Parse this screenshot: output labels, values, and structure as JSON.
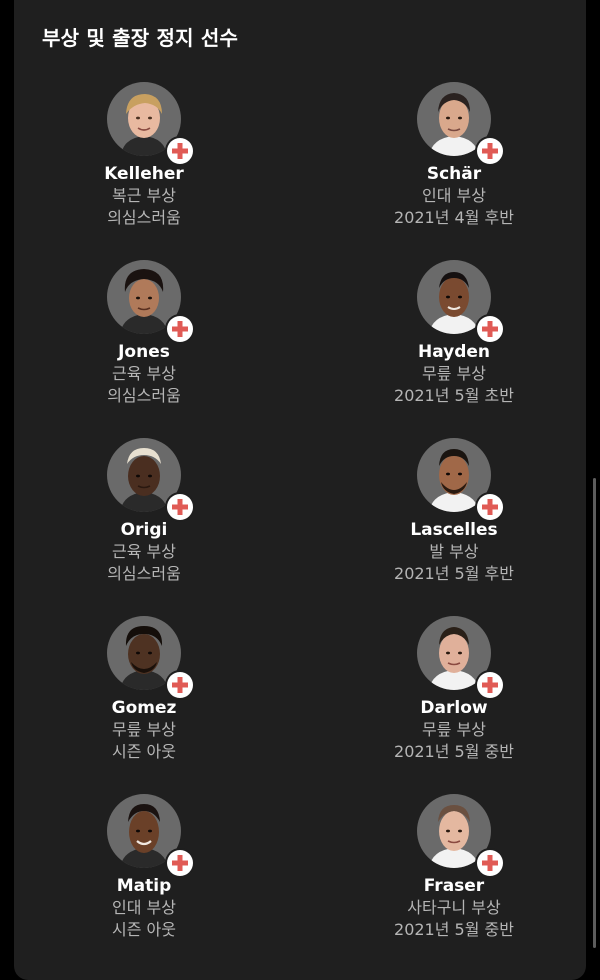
{
  "title": "부상 및 출장 정지 선수",
  "colors": {
    "background": "#1f1f1f",
    "badge_cross": "#e05a55",
    "name_text": "#ffffff",
    "detail_text": "#b5b5b5"
  },
  "players": [
    {
      "name": "Kelleher",
      "injury": "복근 부상",
      "status": "의심스러움",
      "icon": "injury-cross-icon"
    },
    {
      "name": "Schär",
      "injury": "인대 부상",
      "status": "2021년 4월 후반",
      "icon": "injury-cross-icon"
    },
    {
      "name": "Jones",
      "injury": "근육 부상",
      "status": "의심스러움",
      "icon": "injury-cross-icon"
    },
    {
      "name": "Hayden",
      "injury": "무릎 부상",
      "status": "2021년 5월 초반",
      "icon": "injury-cross-icon"
    },
    {
      "name": "Origi",
      "injury": "근육 부상",
      "status": "의심스러움",
      "icon": "injury-cross-icon"
    },
    {
      "name": "Lascelles",
      "injury": "발 부상",
      "status": "2021년 5월 후반",
      "icon": "injury-cross-icon"
    },
    {
      "name": "Gomez",
      "injury": "무릎 부상",
      "status": "시즌 아웃",
      "icon": "injury-cross-icon"
    },
    {
      "name": "Darlow",
      "injury": "무릎 부상",
      "status": "2021년 5월 중반",
      "icon": "injury-cross-icon"
    },
    {
      "name": "Matip",
      "injury": "인대 부상",
      "status": "시즌 아웃",
      "icon": "injury-cross-icon"
    },
    {
      "name": "Fraser",
      "injury": "사타구니 부상",
      "status": "2021년 5월 중반",
      "icon": "injury-cross-icon"
    }
  ]
}
